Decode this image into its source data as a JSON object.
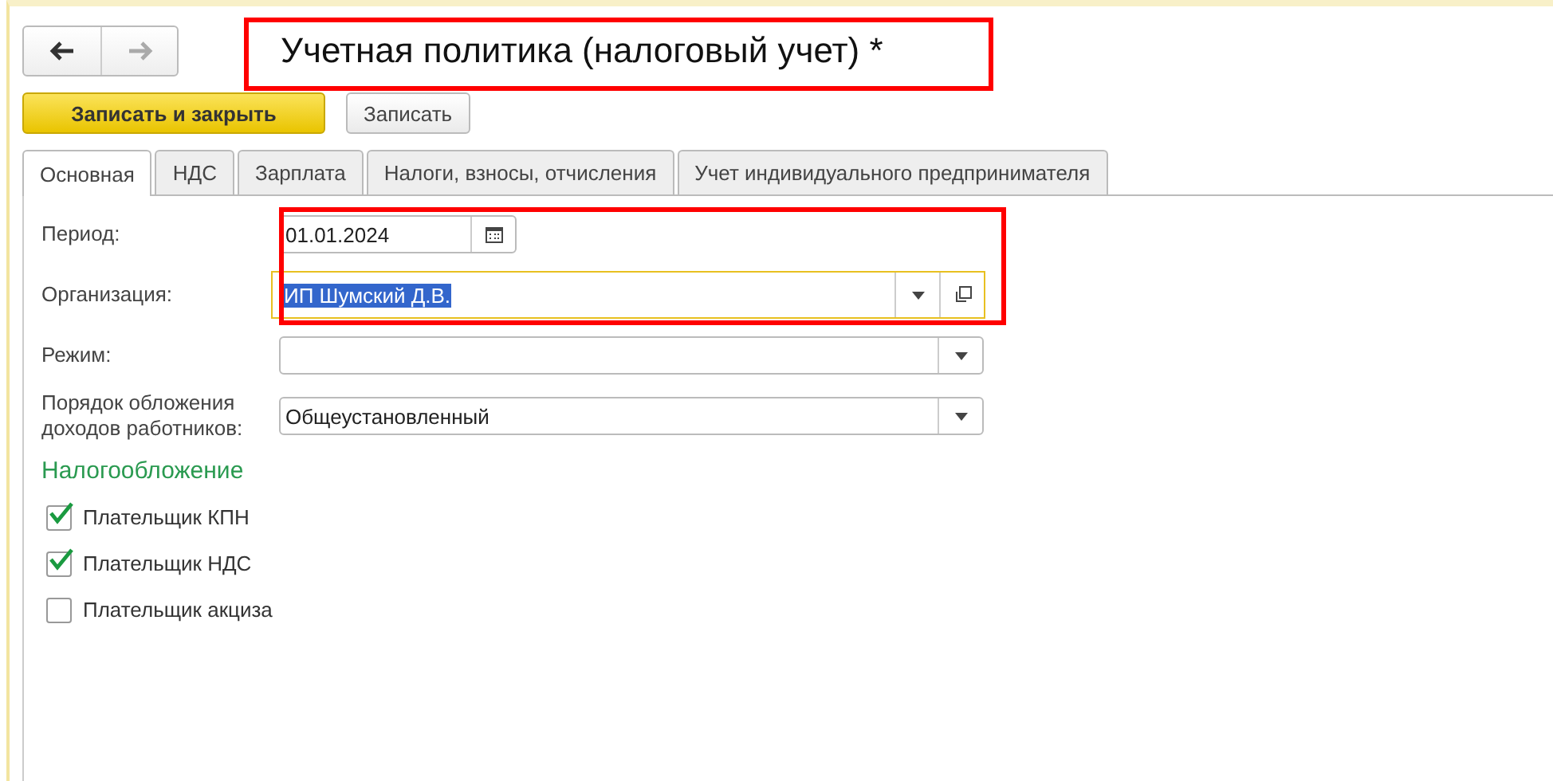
{
  "navigation": [
    {
      "kind": "back",
      "disabled": false
    },
    {
      "kind": "forward",
      "disabled": true
    }
  ],
  "window": {
    "title": "Учетная политика (налоговый учет) *"
  },
  "toolbar": [
    {
      "label": "Записать и закрыть",
      "kind": "primary"
    },
    {
      "label": "Записать",
      "kind": "normal"
    }
  ],
  "tabs": [
    {
      "label": "Основная",
      "selected": true
    },
    {
      "label": "НДС",
      "selected": false
    },
    {
      "label": "Зарплата",
      "selected": false
    },
    {
      "label": "Налоги, взносы, отчисления",
      "selected": false
    },
    {
      "label": "Учет индивидуального предпринимателя",
      "selected": false
    }
  ],
  "fields": [
    {
      "label": "Период:",
      "kind": "date",
      "value": "01.01.2024",
      "focused": false,
      "text_selected": false
    },
    {
      "label": "Организация:",
      "kind": "reference",
      "value": "ИП Шумский Д.В.",
      "focused": true,
      "text_selected": true
    },
    {
      "label": "Режим:",
      "kind": "select",
      "focused": false
    },
    {
      "label": "Порядок обложения доходов работников:",
      "kind": "select",
      "value": "Общеустановленный",
      "focused": false,
      "text_selected": false
    }
  ],
  "taxation": {
    "title": "Налогообложение",
    "checkboxes": [
      {
        "label": "Плательщик КПН",
        "checked": true
      },
      {
        "label": "Плательщик НДС",
        "checked": true
      },
      {
        "label": "Плательщик акциза",
        "checked": false
      }
    ]
  }
}
